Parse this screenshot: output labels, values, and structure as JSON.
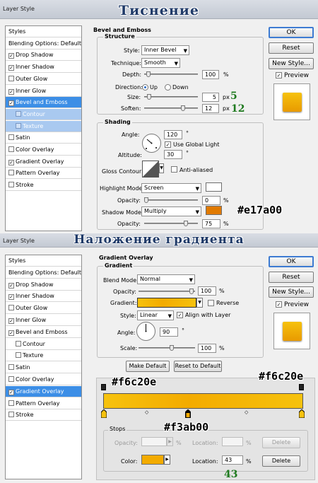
{
  "panel1": {
    "window_title": "Layer Style",
    "overlay_title": "Тиснение",
    "styles_list": [
      {
        "label": "Styles",
        "checked": null
      },
      {
        "label": "Blending Options: Default",
        "checked": null
      },
      {
        "label": "Drop Shadow",
        "checked": true
      },
      {
        "label": "Inner Shadow",
        "checked": true
      },
      {
        "label": "Outer Glow",
        "checked": false
      },
      {
        "label": "Inner Glow",
        "checked": true
      },
      {
        "label": "Bevel and Emboss",
        "checked": true,
        "selected": true
      },
      {
        "label": "Contour",
        "checked": false,
        "sub": true
      },
      {
        "label": "Texture",
        "checked": false,
        "sub": true
      },
      {
        "label": "Satin",
        "checked": false
      },
      {
        "label": "Color Overlay",
        "checked": false
      },
      {
        "label": "Gradient Overlay",
        "checked": true
      },
      {
        "label": "Pattern Overlay",
        "checked": false
      },
      {
        "label": "Stroke",
        "checked": false
      }
    ],
    "section_title": "Bevel and Emboss",
    "structure": {
      "title": "Structure",
      "style_label": "Style:",
      "style_value": "Inner Bevel",
      "technique_label": "Technique:",
      "technique_value": "Smooth",
      "depth_label": "Depth:",
      "depth_value": "100",
      "depth_unit": "%",
      "direction_label": "Direction:",
      "direction_up": "Up",
      "direction_down": "Down",
      "size_label": "Size:",
      "size_value": "5",
      "size_unit": "px",
      "soften_label": "Soften:",
      "soften_value": "12",
      "soften_unit": "px"
    },
    "shading": {
      "title": "Shading",
      "angle_label": "Angle:",
      "angle_value": "120",
      "deg": "°",
      "global_light": "Use Global Light",
      "altitude_label": "Altitude:",
      "altitude_value": "30",
      "gloss_label": "Gloss Contour:",
      "anti_aliased": "Anti-aliased",
      "highlight_mode_label": "Highlight Mode:",
      "highlight_mode_value": "Screen",
      "highlight_opacity_label": "Opacity:",
      "highlight_opacity_value": "0",
      "shadow_mode_label": "Shadow Mode:",
      "shadow_mode_value": "Multiply",
      "shadow_opacity_label": "Opacity:",
      "shadow_opacity_value": "75",
      "percent": "%"
    },
    "buttons": {
      "ok": "OK",
      "reset": "Reset",
      "new_style": "New Style...",
      "preview": "Preview"
    },
    "annotations": {
      "size_note": "5",
      "soften_note": "12",
      "shadow_hex": "#e17a00"
    },
    "colors": {
      "highlight": "#ffffff",
      "shadow": "#e17a00"
    }
  },
  "panel2": {
    "window_title": "Layer Style",
    "overlay_title": "Наложение градиента",
    "styles_list": [
      {
        "label": "Styles",
        "checked": null
      },
      {
        "label": "Blending Options: Default",
        "checked": null
      },
      {
        "label": "Drop Shadow",
        "checked": true
      },
      {
        "label": "Inner Shadow",
        "checked": true
      },
      {
        "label": "Outer Glow",
        "checked": false
      },
      {
        "label": "Inner Glow",
        "checked": true
      },
      {
        "label": "Bevel and Emboss",
        "checked": true
      },
      {
        "label": "Contour",
        "checked": false,
        "sub2": true
      },
      {
        "label": "Texture",
        "checked": false,
        "sub2": true
      },
      {
        "label": "Satin",
        "checked": false
      },
      {
        "label": "Color Overlay",
        "checked": false
      },
      {
        "label": "Gradient Overlay",
        "checked": true,
        "selected": true
      },
      {
        "label": "Pattern Overlay",
        "checked": false
      },
      {
        "label": "Stroke",
        "checked": false
      }
    ],
    "section_title": "Gradient Overlay",
    "gradient": {
      "title": "Gradient",
      "blend_label": "Blend Mode:",
      "blend_value": "Normal",
      "opacity_label": "Opacity:",
      "opacity_value": "100",
      "gradient_label": "Gradient:",
      "reverse": "Reverse",
      "style_label": "Style:",
      "style_value": "Linear",
      "align": "Align with Layer",
      "angle_label": "Angle:",
      "angle_value": "90",
      "deg": "°",
      "scale_label": "Scale:",
      "scale_value": "100",
      "percent": "%"
    },
    "buttons": {
      "ok": "OK",
      "reset": "Reset",
      "new_style": "New Style...",
      "preview": "Preview",
      "make_default": "Make Default",
      "reset_default": "Reset to Default"
    },
    "stops": {
      "title": "Stops",
      "opacity_label": "Opacity:",
      "opacity_unit": "%",
      "location_label": "Location:",
      "location_unit": "%",
      "delete": "Delete",
      "color_label": "Color:",
      "color_location_label": "Location:",
      "color_location_value": "43",
      "color_location_unit": "%",
      "delete2": "Delete"
    },
    "annotations": {
      "left_hex": "#f6c20e",
      "right_hex": "#f6c20e",
      "mid_hex": "#f3ab00",
      "location_note": "43"
    },
    "colors": {
      "stop_left": "#f6c20e",
      "stop_mid": "#f3ab00",
      "stop_right": "#f6c20e"
    }
  }
}
